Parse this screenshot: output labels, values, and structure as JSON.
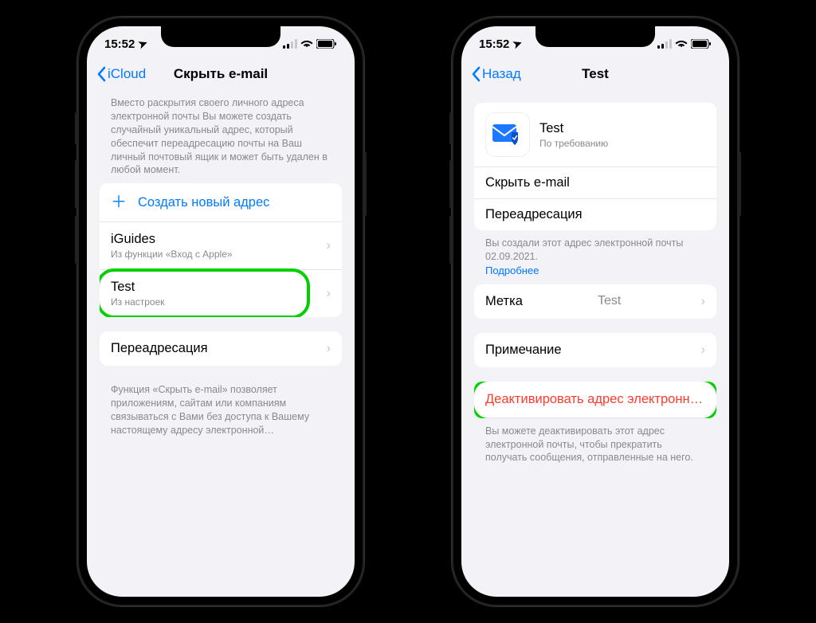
{
  "statusBar": {
    "time": "15:52",
    "locationGlyph": "➤"
  },
  "left": {
    "nav": {
      "back": "iCloud",
      "title": "Скрыть e-mail"
    },
    "intro": "Вместо раскрытия своего личного адреса электронной почты Вы можете создать случайный уникальный адрес, который обеспечит переадресацию почты на Ваш личный почтовый ящик и может быть удален в любой момент.",
    "create": "Создать новый адрес",
    "items": [
      {
        "title": "iGuides",
        "subtitle": "Из функции «Вход с Apple»"
      },
      {
        "title": "Test",
        "subtitle": "Из настроек"
      }
    ],
    "forward": "Переадресация",
    "footerInfo": "Функция «Скрыть e-mail» позволяет приложениям, сайтам или компаниям связываться с Вами без доступа к Вашему настоящему адресу электронной…"
  },
  "right": {
    "nav": {
      "back": "Назад",
      "title": "Test"
    },
    "card": {
      "title": "Test",
      "subtitle": "По требованию"
    },
    "hideRow": "Скрыть e-mail",
    "forwardRow": "Переадресация",
    "createdInfo": "Вы создали этот адрес электронной почты 02.09.2021.",
    "more": "Подробнее",
    "label": {
      "title": "Метка",
      "value": "Test"
    },
    "note": "Примечание",
    "deactivate": "Деактивировать адрес электронной п…",
    "deactivateInfo": "Вы можете деактивировать этот адрес электронной почты, чтобы прекратить получать сообщения, отправленные на него."
  }
}
